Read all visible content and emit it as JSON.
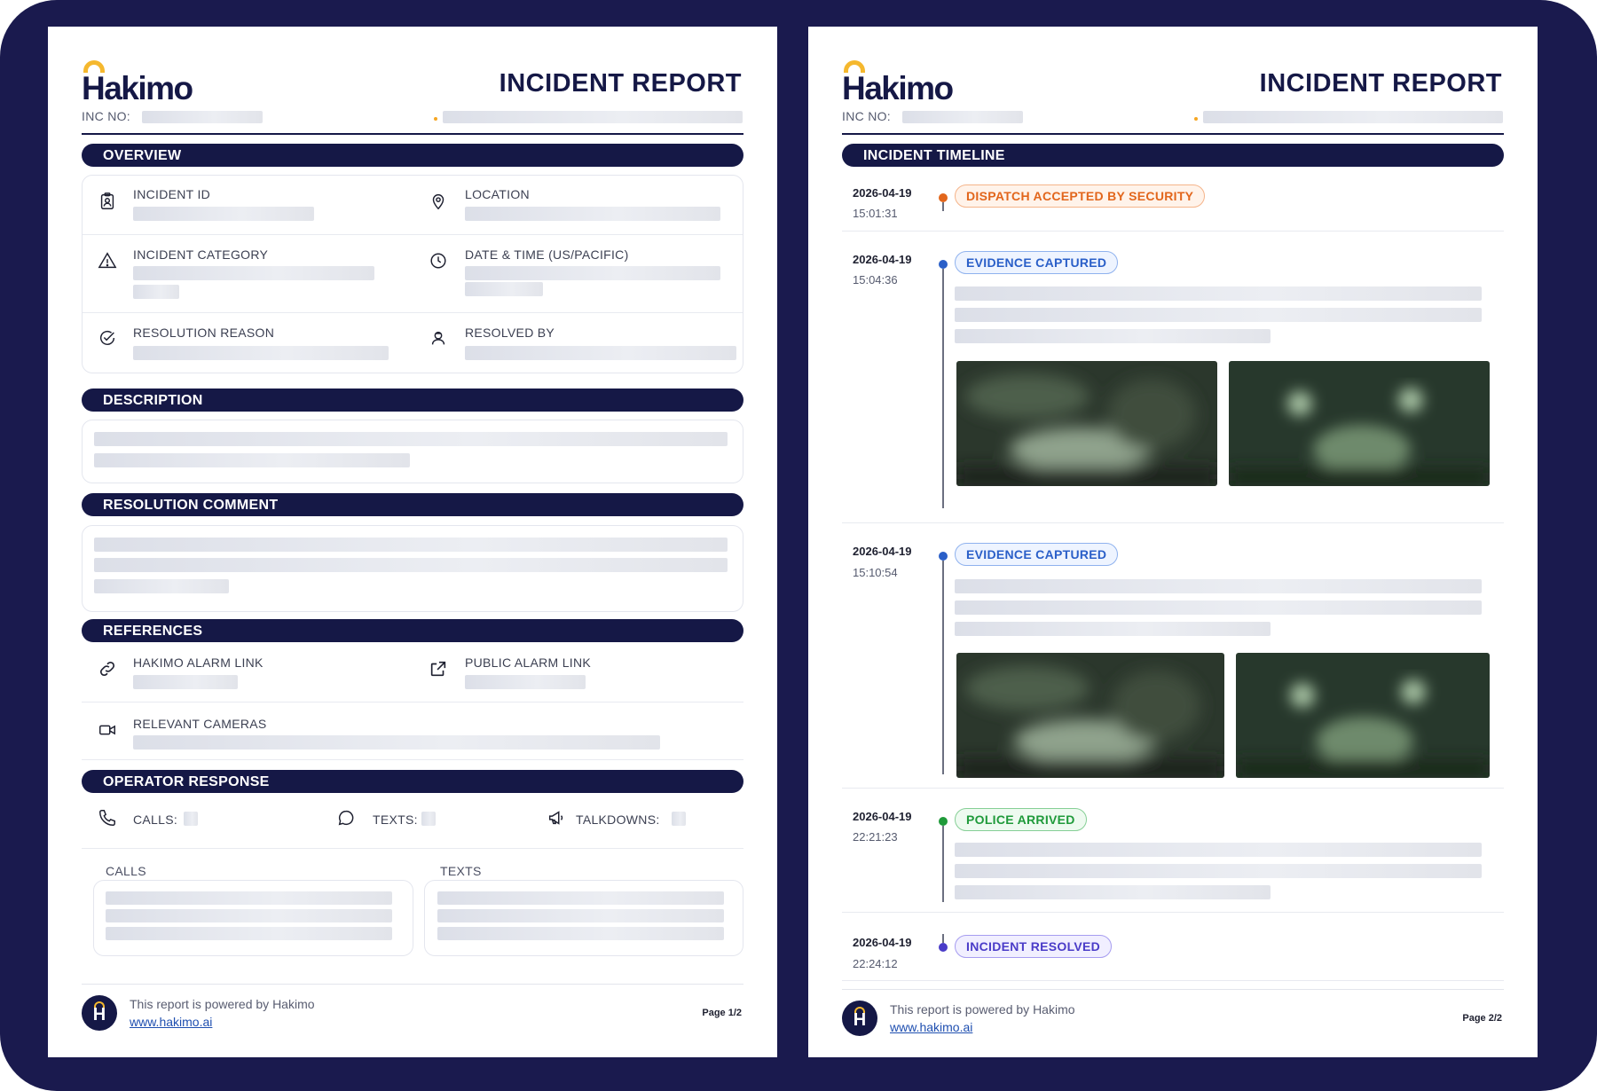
{
  "brand": {
    "name": "Hakimo",
    "accent": "#f5b82e",
    "navy": "#151846"
  },
  "header": {
    "title": "INCIDENT REPORT",
    "inc_no_label": "INC NO:"
  },
  "page1": {
    "overview": {
      "heading": "OVERVIEW",
      "incident_id": "INCIDENT ID",
      "location": "LOCATION",
      "incident_category": "INCIDENT CATEGORY",
      "date_time": "DATE & TIME (US/PACIFIC)",
      "resolution_reason": "RESOLUTION REASON",
      "resolved_by": "RESOLVED BY"
    },
    "description": {
      "heading": "DESCRIPTION"
    },
    "resolution_comment": {
      "heading": "RESOLUTION COMMENT"
    },
    "references": {
      "heading": "REFERENCES",
      "hakimo_alarm_link": "HAKIMO ALARM LINK",
      "public_alarm_link": "PUBLIC ALARM LINK",
      "relevant_cameras": "RELEVANT CAMERAS"
    },
    "operator_response": {
      "heading": "OPERATOR RESPONSE",
      "calls": "CALLS:",
      "texts": "TEXTS:",
      "talkdowns": "TALKDOWNS:",
      "calls_col": "CALLS",
      "texts_col": "TEXTS"
    },
    "page_number": "Page 1/2"
  },
  "page2": {
    "timeline_heading": "INCIDENT TIMELINE",
    "events": [
      {
        "date": "2026-04-19",
        "time": "15:01:31",
        "label": "DISPATCH ACCEPTED BY SECURITY",
        "color": "#e2661c"
      },
      {
        "date": "2026-04-19",
        "time": "15:04:36",
        "label": "EVIDENCE CAPTURED",
        "color": "#2a5fc8"
      },
      {
        "date": "2026-04-19",
        "time": "15:10:54",
        "label": "EVIDENCE CAPTURED",
        "color": "#2a5fc8"
      },
      {
        "date": "2026-04-19",
        "time": "22:21:23",
        "label": "POLICE ARRIVED",
        "color": "#1f9a3a"
      },
      {
        "date": "2026-04-19",
        "time": "22:24:12",
        "label": "INCIDENT RESOLVED",
        "color": "#4a3cc8"
      }
    ],
    "page_number": "Page 2/2"
  },
  "footer": {
    "powered_by": "This report is powered by Hakimo",
    "link": "www.hakimo.ai",
    "logo_letter": "H"
  }
}
